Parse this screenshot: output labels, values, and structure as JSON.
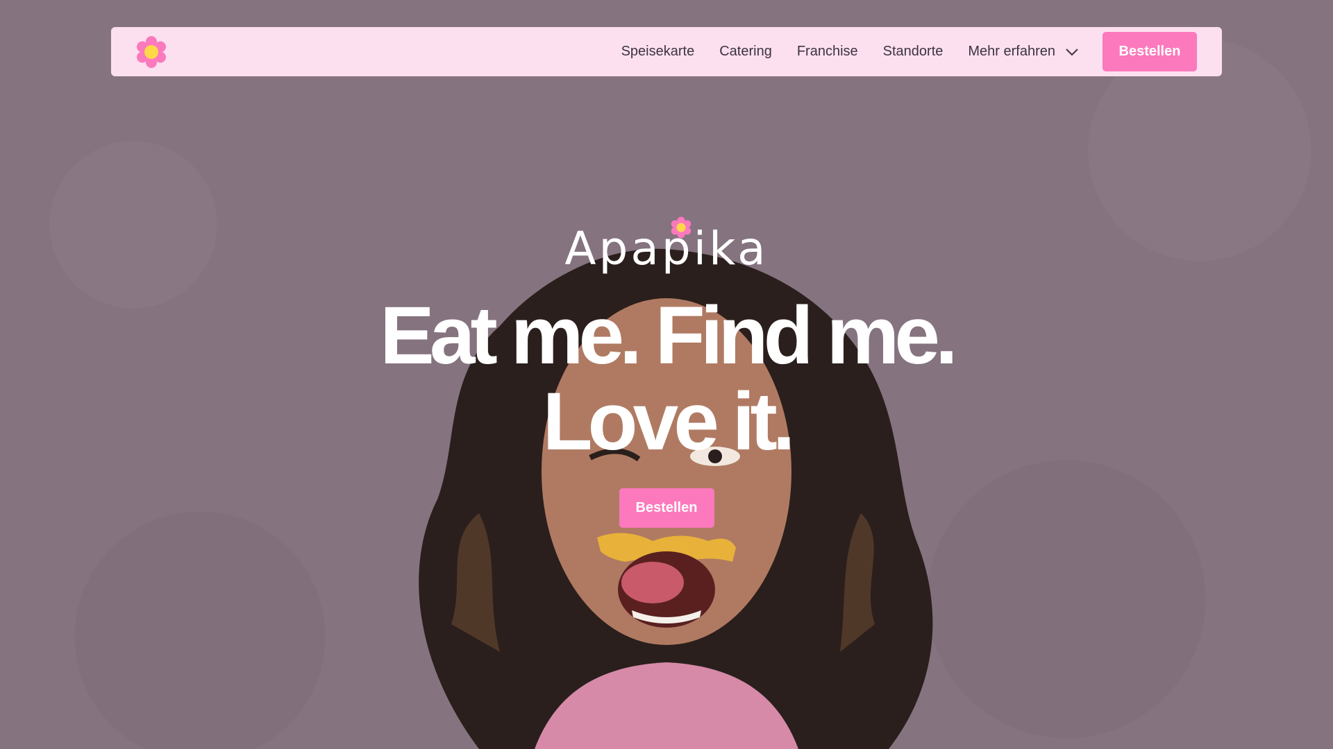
{
  "colors": {
    "background": "#85737f",
    "navbar": "#fde0f0",
    "accent": "#fb79bc",
    "flower_center": "#ffd84a",
    "text_dark": "#3b3340",
    "text_light": "#ffffff"
  },
  "navbar": {
    "logo_icon": "flower-icon",
    "links": [
      "Speisekarte",
      "Catering",
      "Franchise",
      "Standorte"
    ],
    "dropdown": {
      "label": "Mehr erfahren",
      "icon": "chevron-down-icon"
    },
    "cta_label": "Bestellen"
  },
  "hero": {
    "brand": "Apapika",
    "headline_line1": "Eat me. Find me.",
    "headline_line2": "Love it.",
    "cta_label": "Bestellen",
    "image": "woman-with-curly-hair-eating-snack"
  }
}
